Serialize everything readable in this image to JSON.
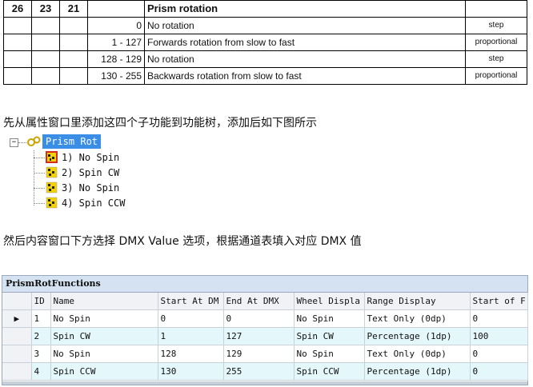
{
  "spec_table": {
    "header": {
      "a": "26",
      "b": "23",
      "c": "21",
      "d": "",
      "e": "Prism rotation",
      "f": ""
    },
    "rows": [
      {
        "range": "0",
        "desc": "No rotation",
        "type": "step"
      },
      {
        "range": "1 - 127",
        "desc": "Forwards rotation from slow to fast",
        "type": "proportional"
      },
      {
        "range": "128 - 129",
        "desc": "No rotation",
        "type": "step"
      },
      {
        "range": "130 - 255",
        "desc": "Backwards rotation from slow to fast",
        "type": "proportional"
      }
    ]
  },
  "paragraph1": "先从属性窗口里添加这四个子功能到功能树，添加后如下图所示",
  "tree": {
    "expander": "−",
    "root_label": "Prism Rot",
    "children": [
      {
        "label": "1) No Spin",
        "icon": "spin-red-icon"
      },
      {
        "label": "2) Spin CW",
        "icon": "spin-icon"
      },
      {
        "label": "3) No Spin",
        "icon": "spin-icon"
      },
      {
        "label": "4) Spin CCW",
        "icon": "spin-icon"
      }
    ]
  },
  "paragraph2": "然后内容窗口下方选择 DMX Value 选项，根据通道表填入对应 DMX 值",
  "grid": {
    "title": "PrismRotFunctions",
    "columns": [
      "ID",
      "Name",
      "Start At DM",
      "End At DMX",
      "Wheel Displa",
      "Range Display",
      "Start of F"
    ],
    "rows": [
      {
        "pointer": "▶",
        "id": "1",
        "name": "No Spin",
        "start": "0",
        "end": "0",
        "wheel": "No Spin",
        "range": "Text Only (0dp)",
        "startf": "0"
      },
      {
        "pointer": "",
        "id": "2",
        "name": "Spin CW",
        "start": "1",
        "end": "127",
        "wheel": "Spin CW",
        "range": "Percentage (1dp)",
        "startf": "100"
      },
      {
        "pointer": "",
        "id": "3",
        "name": "No Spin",
        "start": "128",
        "end": "129",
        "wheel": "No Spin",
        "range": "Text Only (0dp)",
        "startf": "0"
      },
      {
        "pointer": "",
        "id": "4",
        "name": "Spin CCW",
        "start": "130",
        "end": "255",
        "wheel": "Spin CCW",
        "range": "Percentage (1dp)",
        "startf": "0"
      }
    ]
  }
}
